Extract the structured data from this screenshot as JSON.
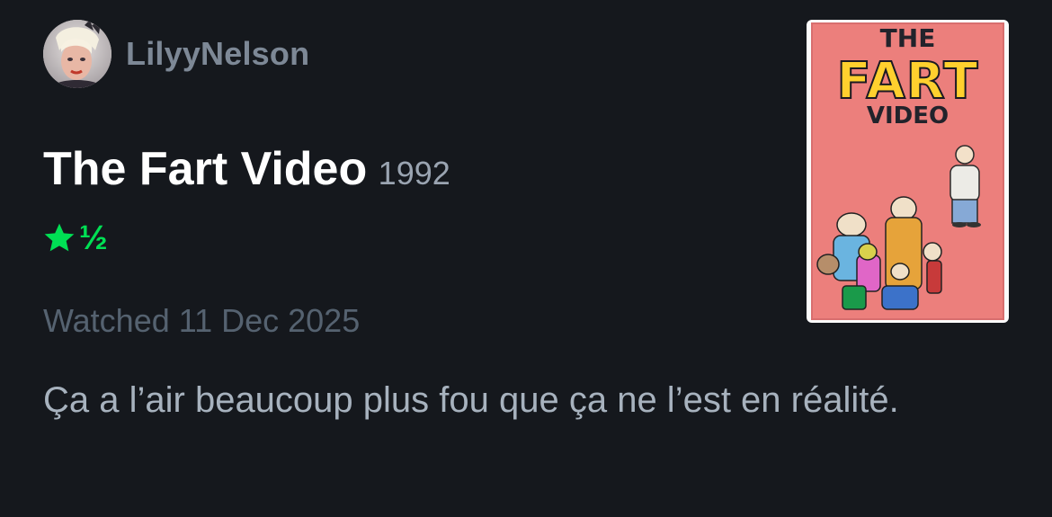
{
  "review": {
    "username": "LilyyNelson",
    "film_title": "The Fart Video",
    "film_year": "1992",
    "rating": {
      "stars": 1.5,
      "out_of": 5,
      "half_glyph": "½",
      "color": "#00e054"
    },
    "watched": "Watched 11 Dec 2025",
    "text": "Ça a l’air beaucoup plus fou que ça ne l’est en réalité."
  },
  "poster": {
    "line1": "THE",
    "line2": "FART",
    "line3": "VIDEO"
  },
  "icons": {
    "rating": "star-icon",
    "avatar": "user-avatar"
  }
}
